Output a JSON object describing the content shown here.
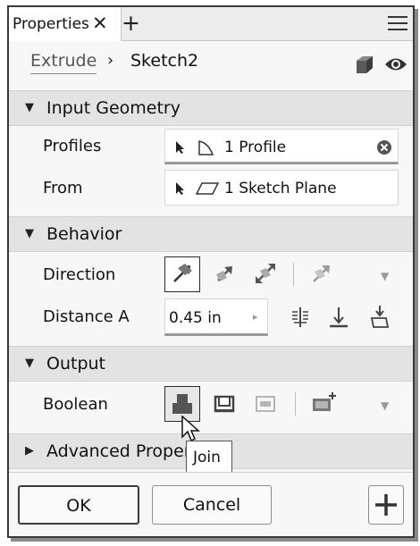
{
  "panel": {
    "tab_label": "Properties",
    "tab_close_glyph": "✕",
    "tab_add_glyph": "+"
  },
  "breadcrumb": {
    "parent": "Extrude",
    "separator": "›",
    "current": "Sketch2"
  },
  "sections": {
    "input_geometry": {
      "title": "Input Geometry",
      "expanded": true,
      "rows": {
        "profiles": {
          "label": "Profiles",
          "value": "1 Profile"
        },
        "from": {
          "label": "From",
          "value": "1 Sketch Plane"
        }
      }
    },
    "behavior": {
      "title": "Behavior",
      "expanded": true,
      "rows": {
        "direction": {
          "label": "Direction",
          "selected": "default"
        },
        "distance_a": {
          "label": "Distance A",
          "value": "0.45 in"
        }
      }
    },
    "output": {
      "title": "Output",
      "expanded": true,
      "rows": {
        "boolean": {
          "label": "Boolean",
          "selected": "join"
        }
      }
    },
    "advanced": {
      "title": "Advanced Properties",
      "expanded": false
    }
  },
  "tooltip": {
    "text": "Join"
  },
  "footer": {
    "ok_label": "OK",
    "cancel_label": "Cancel"
  },
  "icons": {
    "tab_menu": "hamburger-icon",
    "visibility": "eye-icon",
    "appearance": "cube-icon",
    "clear_selection": "close-circle-icon"
  },
  "colors": {
    "panel_bg": "#f7f7f7",
    "section_bg": "#e3e3e3",
    "icon_gray": "#4a4a4a"
  }
}
